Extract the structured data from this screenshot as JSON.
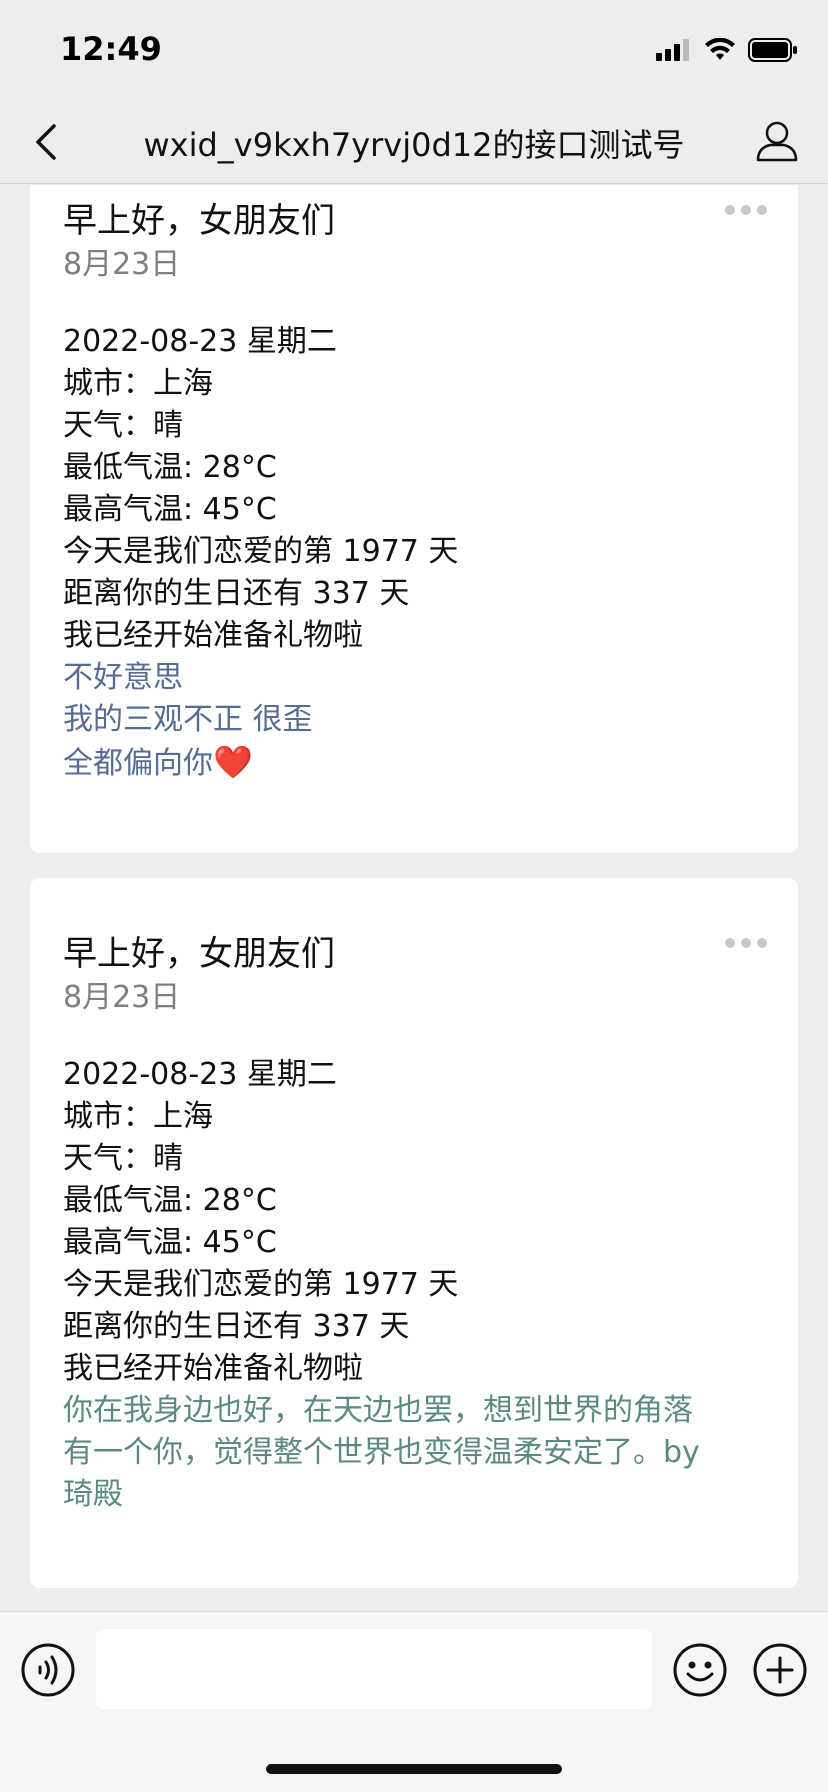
{
  "status_bar": {
    "time": "12:49"
  },
  "nav": {
    "title": "wxid_v9kxh7yrvj0d12的接口测试号"
  },
  "cards": [
    {
      "title": "早上好，女朋友们",
      "date": "8月23日",
      "lines": [
        "2022-08-23 星期二",
        "城市：上海",
        "天气：晴",
        "最低气温: 28°C",
        "最高气温: 45°C",
        "今天是我们恋爱的第 1977 天",
        "距离你的生日还有 337 天",
        "我已经开始准备礼物啦"
      ],
      "quote_lines": [
        "不好意思",
        "我的三观不正  很歪",
        "全都偏向你"
      ],
      "quote_emoji": "❤️",
      "quote_color": "#576b95"
    },
    {
      "title": "早上好，女朋友们",
      "date": "8月23日",
      "lines": [
        "2022-08-23 星期二",
        "城市：上海",
        "天气：晴",
        "最低气温: 28°C",
        "最高气温: 45°C",
        "今天是我们恋爱的第 1977 天",
        "距离你的生日还有 337 天",
        "我已经开始准备礼物啦"
      ],
      "quote_lines": [
        "你在我身边也好，在天边也罢，想到世界的角落",
        "有一个你，觉得整个世界也变得温柔安定了。by",
        "琦殿"
      ],
      "quote_color": "#5a8a82"
    }
  ],
  "input_bar": {
    "voice_icon": "voice-icon",
    "emoji_icon": "emoji-icon",
    "plus_icon": "plus-icon"
  }
}
